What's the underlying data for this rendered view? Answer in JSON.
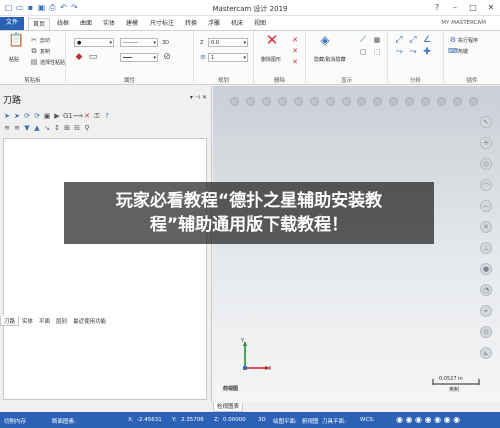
{
  "window": {
    "title": "Mastercam 设计 2019",
    "account": "MY MASTERCAM"
  },
  "quick_access": [
    "new-icon",
    "open-icon",
    "save-icon",
    "save-as-icon",
    "print-icon",
    "undo-icon",
    "redo-icon"
  ],
  "tabs": [
    "文件",
    "首页",
    "线框",
    "曲面",
    "实体",
    "建模",
    "尺寸标注",
    "转换",
    "浮雕",
    "机床",
    "视图"
  ],
  "ribbon": {
    "clipboard": {
      "label": "剪贴板",
      "paste": "粘贴",
      "cut": "剪切",
      "copy": "复制",
      "paste_special": "选择性粘贴"
    },
    "attributes": {
      "label": "属性",
      "three_d": "3D"
    },
    "planning": {
      "label": "规划",
      "z_label": "Z",
      "z_value": "0.0",
      "layer_value": "1"
    },
    "delete": {
      "label": "删除",
      "delete_entity": "删除图形"
    },
    "display": {
      "label": "显示",
      "hide_show": "隐藏/取消隐藏"
    },
    "analyze": {
      "label": "分析"
    },
    "addins": {
      "label": "插件",
      "run_addin": "执行程序",
      "hotkeys": "热键"
    }
  },
  "toolpaths_panel": {
    "title": "刀路",
    "tabs": [
      "刀路",
      "实体",
      "平面",
      "层别",
      "最近使用功能"
    ]
  },
  "viewport": {
    "axis_x": "X",
    "axis_y": "Y",
    "view_name": "前视图",
    "scale_value": "0.0527 in",
    "scale_unit": "英制",
    "tab": "检视图表"
  },
  "status_bar": {
    "section": "切削内存",
    "view_label": "断面图素:",
    "x_label": "X:",
    "x_value": "-2.45631",
    "y_label": "Y:",
    "y_value": "2.35706",
    "z_label": "Z:",
    "z_value": "0.00000",
    "mode": "3D",
    "cplane_label": "绘图平面:",
    "cplane_value": "俯视图",
    "tplane_label": "刀具平面:",
    "wcs_label": "WCS:"
  },
  "overlay": {
    "line1": "玩家必看教程“德扑之星辅助安装教",
    "line2": "程”辅助通用版下载教程！"
  },
  "colors": {
    "accent": "#2b62b5",
    "axis_x": "#d01b1b",
    "axis_y": "#1d8a2b",
    "delete_red": "#d03232"
  }
}
